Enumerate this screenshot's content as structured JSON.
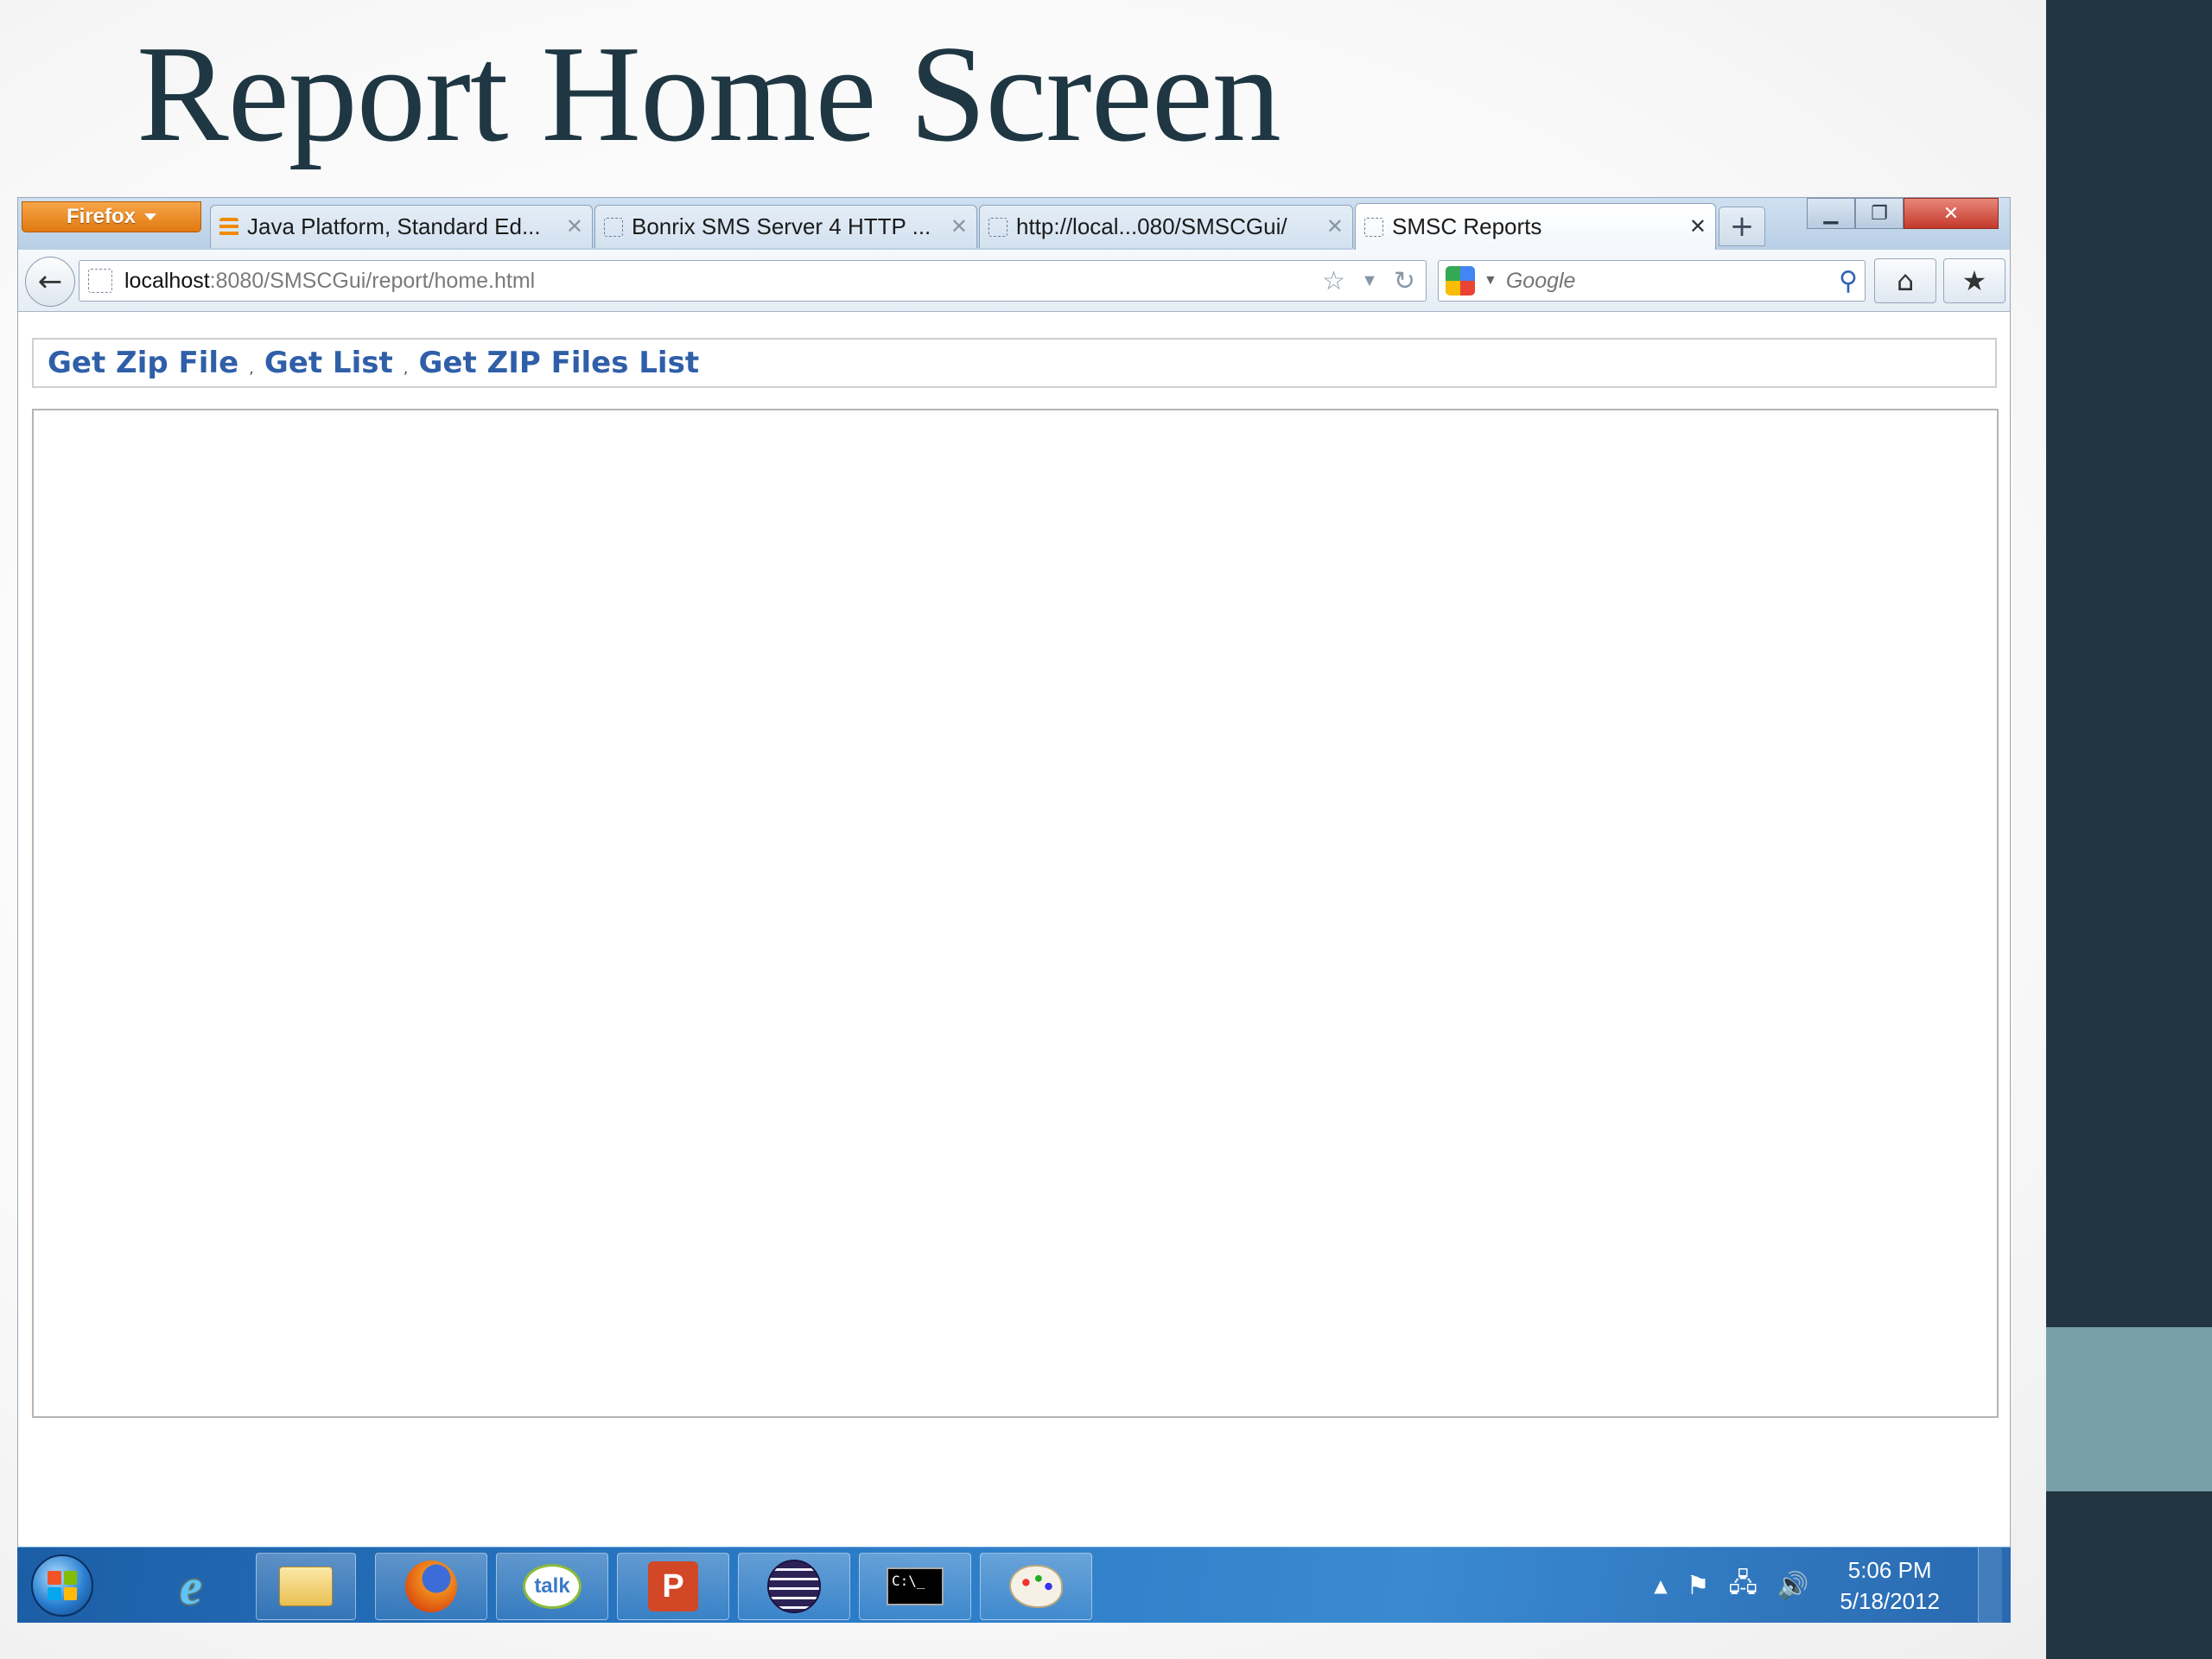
{
  "slide": {
    "title": "Report Home Screen"
  },
  "browser": {
    "menu_button_label": "Firefox",
    "tabs": [
      {
        "title": "Java Platform, Standard Ed...",
        "active": false
      },
      {
        "title": "Bonrix SMS Server 4 HTTP ...",
        "active": false
      },
      {
        "title": "http://local...080/SMSCGui/",
        "active": false
      },
      {
        "title": "SMSC Reports",
        "active": true
      }
    ],
    "new_tab_label": "+",
    "url": {
      "host": "localhost",
      "path": ":8080/SMSCGui/report/home.html"
    },
    "search": {
      "placeholder": "Google"
    }
  },
  "page": {
    "links": [
      "Get Zip File",
      "Get List",
      "Get ZIP Files List"
    ],
    "separator": ","
  },
  "taskbar": {
    "pinned_apps": [
      "Internet Explorer",
      "Windows Explorer",
      "Firefox",
      "Google Talk",
      "PowerPoint",
      "Eclipse",
      "Command Prompt",
      "Paint"
    ],
    "talk_label": "talk",
    "ppt_label": "P",
    "cmd_label": "C:\\_",
    "clock": {
      "time": "5:06 PM",
      "date": "5/18/2012"
    }
  },
  "colors": {
    "slide_title": "#1f3743",
    "right_bar": "#213641",
    "right_accent": "#77a0a9",
    "link": "#2f5fa8",
    "firefox_button": "#e07a10"
  }
}
